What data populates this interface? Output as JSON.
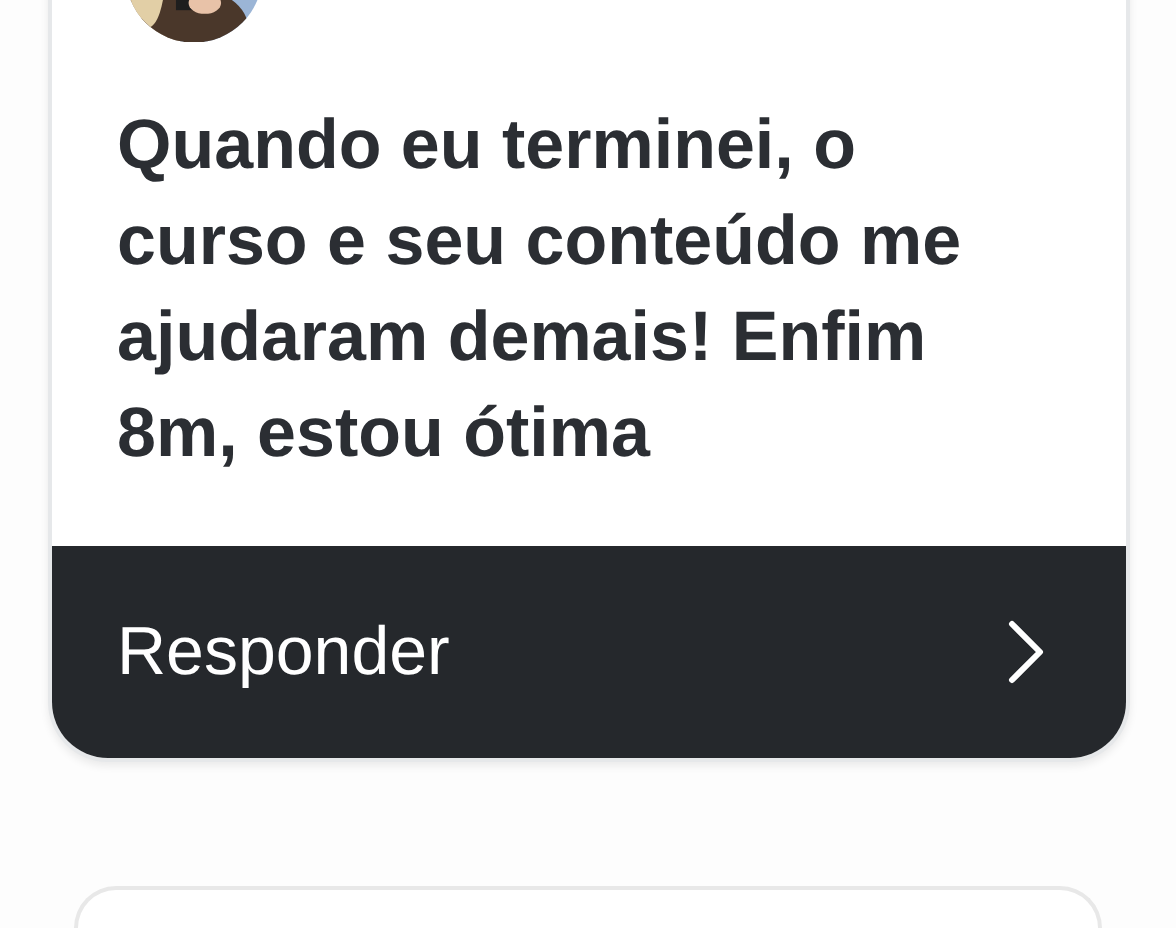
{
  "post": {
    "message": "Quando eu terminei, o curso e seu conteúdo me ajudaram demais! Enfim 8m, estou ótima",
    "reply_button": {
      "label": "Responder"
    }
  }
}
